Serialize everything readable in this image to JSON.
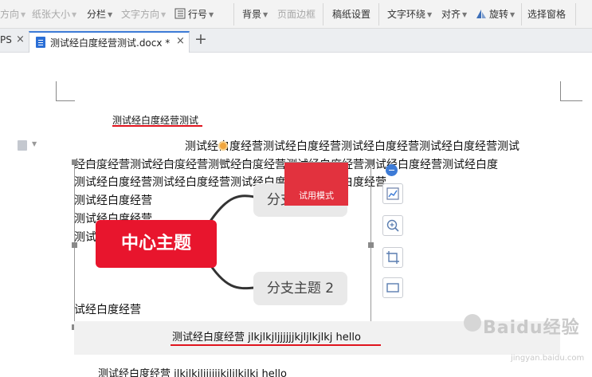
{
  "toolbar": {
    "items": [
      {
        "label": "方向",
        "dim": true
      },
      {
        "label": "纸张大小",
        "dim": true
      },
      {
        "label": "分栏"
      },
      {
        "label": "文字方向",
        "dim": true
      },
      {
        "label": "行号"
      },
      {
        "label": "背景"
      },
      {
        "label": "页面边框",
        "dim": true
      },
      {
        "label": "稿纸设置"
      },
      {
        "label": "文字环绕"
      },
      {
        "label": "对齐"
      },
      {
        "label": "旋转"
      },
      {
        "label": "选择窗格"
      }
    ]
  },
  "tabs": {
    "prev_label": "PS",
    "active_title": "测试经白度经营测试.docx *",
    "close_glyph": "×",
    "add_glyph": "+"
  },
  "document": {
    "title_line": "测试经白度经营测试",
    "line1": "测试经白度经营测试经白度经营测试经白度经营测试经白度经营测试",
    "line2": "经白度经营测试经白度经营测试经白度经营测试经白度经营测试经白度经营测试经白度",
    "line3": "测试经白度经营测试经白度经营测试经白度经营测试经白度经营",
    "line4": "测试经白度经营",
    "line5": "测试经白度经营",
    "line6": "测试经白度经营",
    "line7": "试经白度经营",
    "highlight_line": "测试经白度经营 jlkjlkjljjjjjjkjljlkjlkj    hello",
    "bottom_line": "测试经白度经营 jlkjlkjljjjjjjkjljlkjlkj    hello"
  },
  "mindmap": {
    "center": "中心主题",
    "branch1": "分支主题 1",
    "branch2": "分支主题 2",
    "trial_badge": "试用模式"
  },
  "watermark": {
    "brand": "Baidu经验",
    "url": "jingyan.baidu.com"
  },
  "colors": {
    "accent_blue": "#3d7bd6",
    "mindmap_red": "#e8152d",
    "underline_red": "#e0141e"
  }
}
